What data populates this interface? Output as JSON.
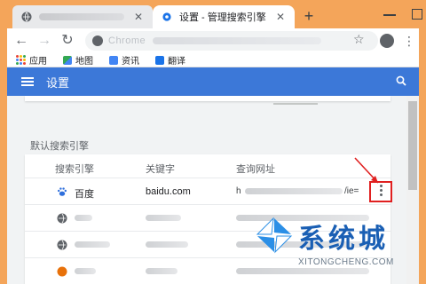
{
  "tabs": [
    {
      "title": "",
      "active": false
    },
    {
      "title": "设置 - 管理搜索引擎",
      "active": true
    }
  ],
  "toolbar": {
    "url_prefix": "Chrome"
  },
  "bookmarks": [
    {
      "label": "应用",
      "icon": "apps-icon"
    },
    {
      "label": "地图",
      "icon": "maps-icon"
    },
    {
      "label": "资讯",
      "icon": "news-icon"
    },
    {
      "label": "翻译",
      "icon": "translate-icon"
    }
  ],
  "header": {
    "title": "设置"
  },
  "section": {
    "title": "默认搜索引擎"
  },
  "table": {
    "columns": [
      "搜索引擎",
      "关键字",
      "查询网址"
    ],
    "rows": [
      {
        "engine": "百度",
        "keyword": "baidu.com",
        "url": "h",
        "url_suffix": "/ie="
      }
    ]
  },
  "watermark": {
    "text": "系统城",
    "sub": "XITONGCHENG.COM"
  },
  "colors": {
    "frame": "#f4a55a",
    "header": "#3c78d8",
    "highlight": "#e02020",
    "watermark": "#1a5fb4"
  }
}
